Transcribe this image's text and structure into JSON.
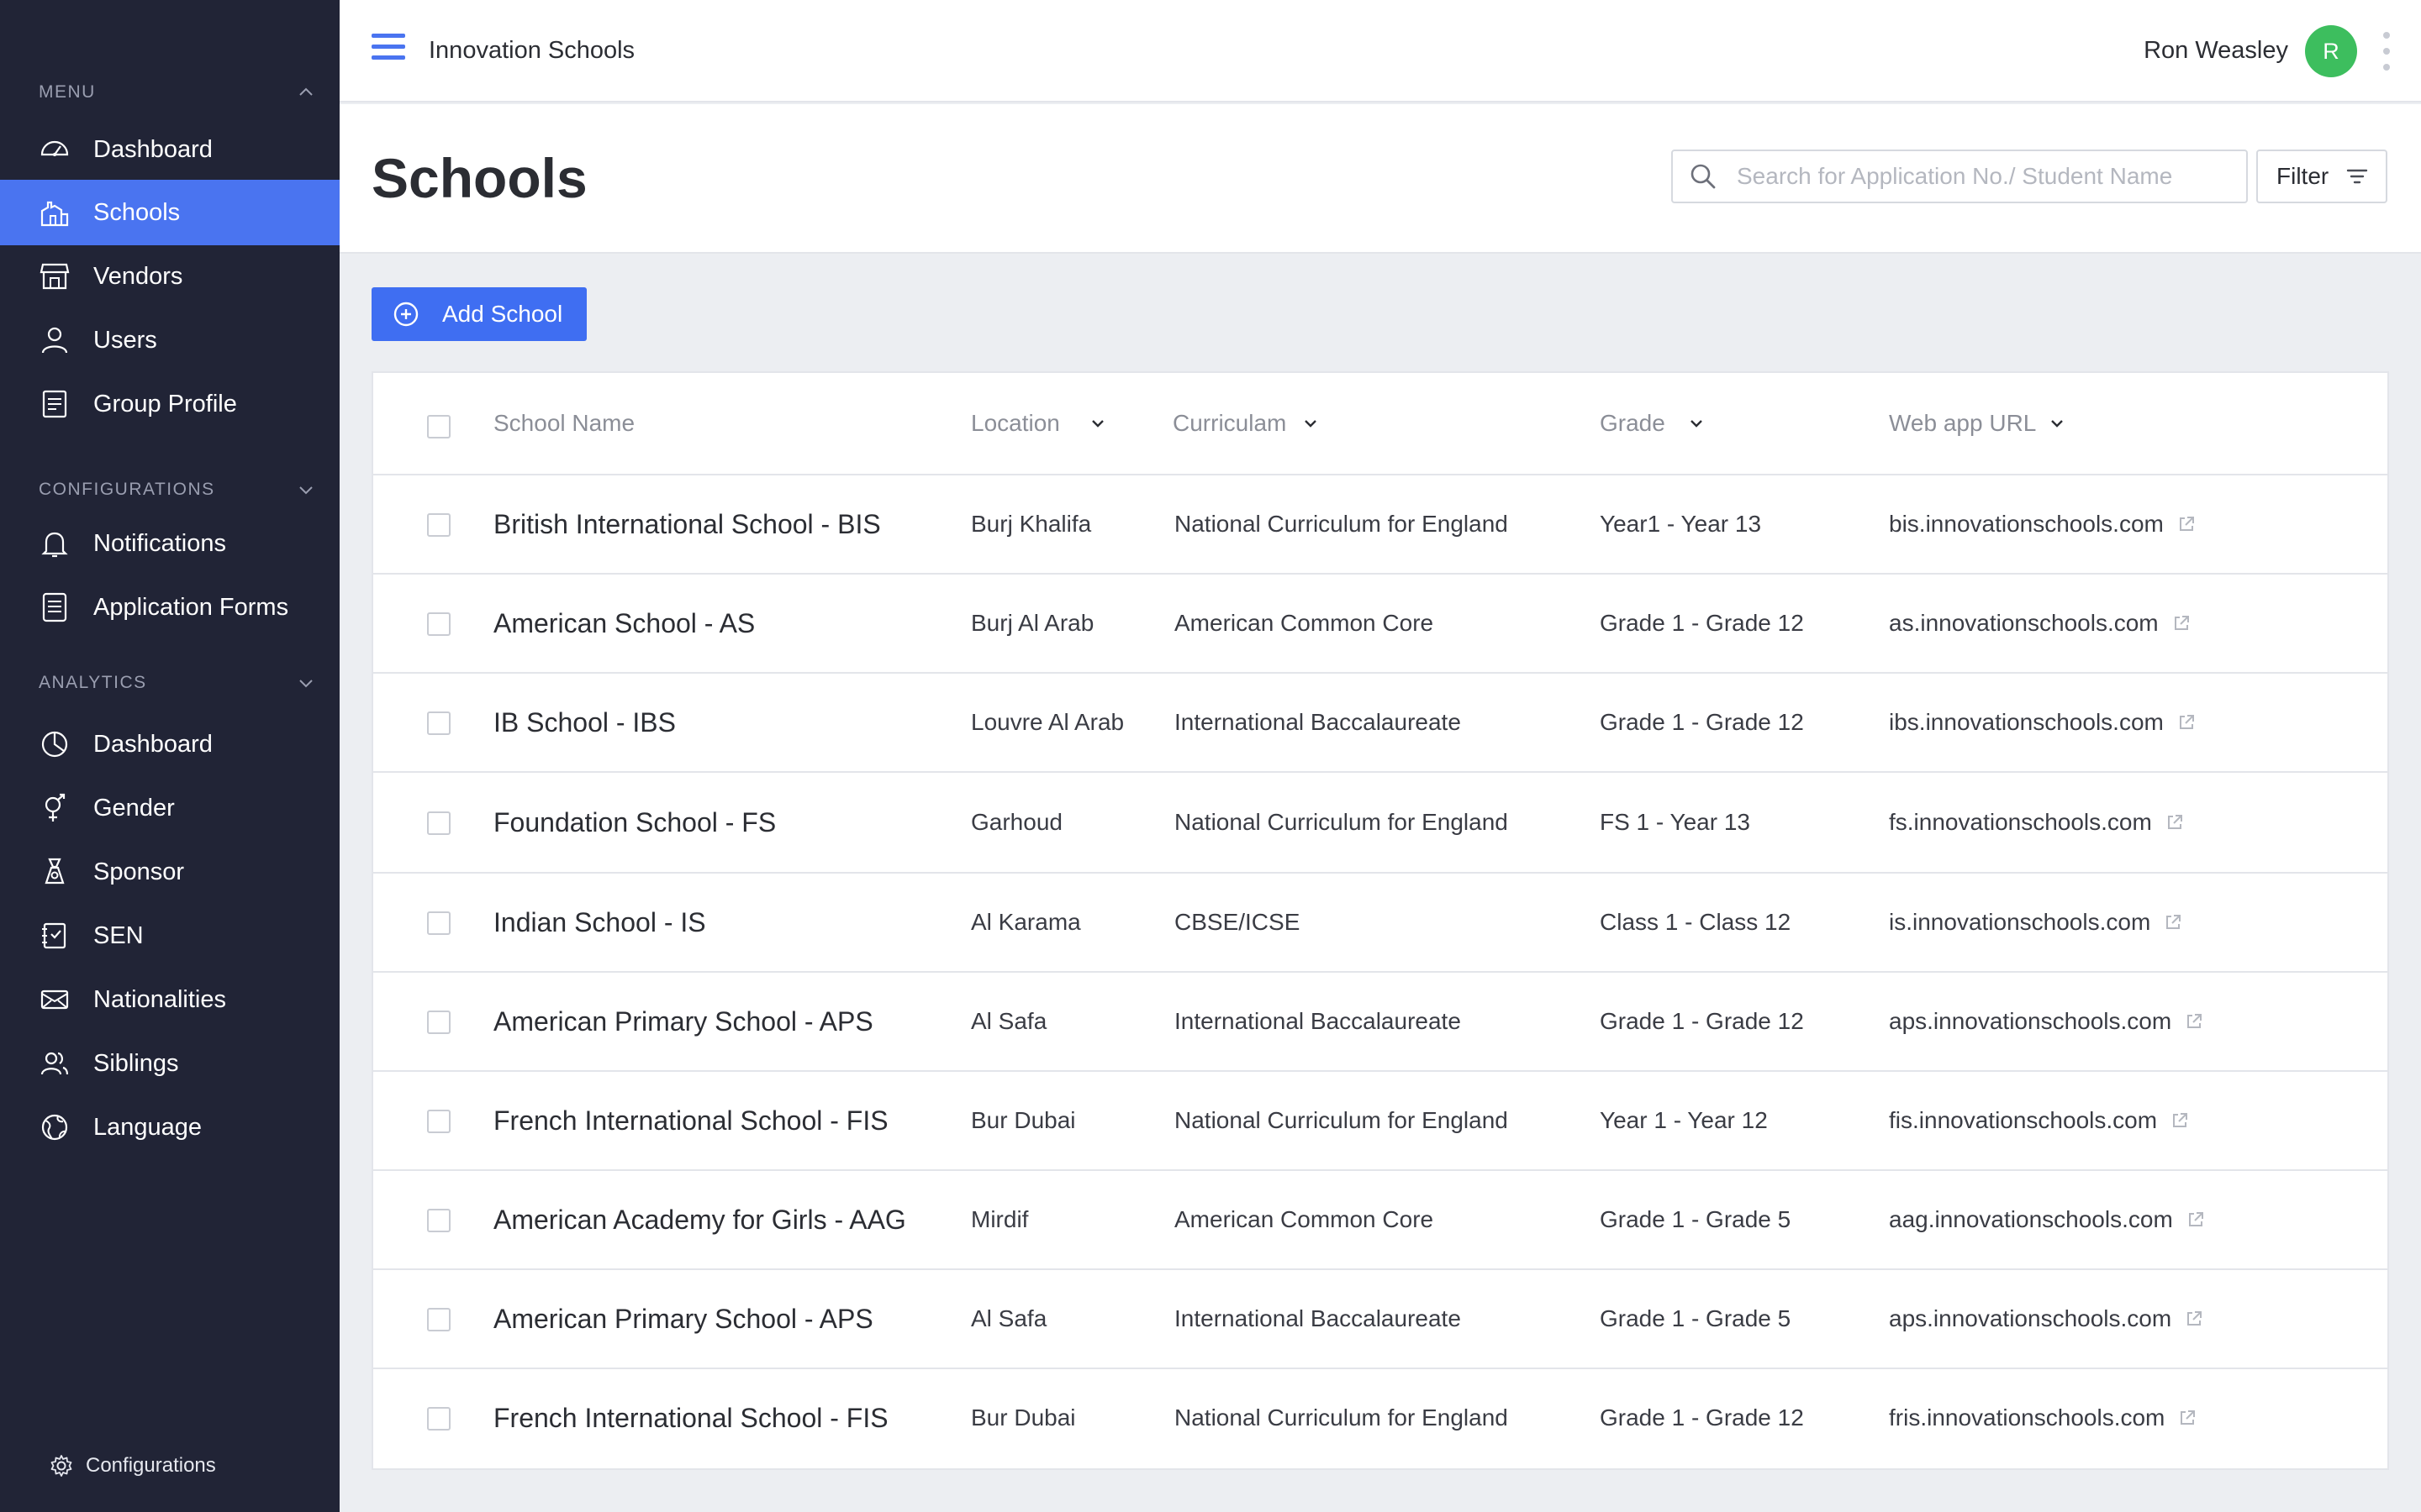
{
  "sidebar": {
    "menu_label": "MENU",
    "menu_items": [
      {
        "label": "Dashboard",
        "icon": "dashboard-icon",
        "active": false
      },
      {
        "label": "Schools",
        "icon": "school-icon",
        "active": true
      },
      {
        "label": "Vendors",
        "icon": "store-icon",
        "active": false
      },
      {
        "label": "Users",
        "icon": "user-icon",
        "active": false
      },
      {
        "label": "Group Profile",
        "icon": "profile-icon",
        "active": false
      }
    ],
    "config_label": "CONFIGURATIONS",
    "config_items": [
      {
        "label": "Notifications",
        "icon": "bell-icon"
      },
      {
        "label": "Application Forms",
        "icon": "form-icon"
      }
    ],
    "analytics_label": "ANALYTICS",
    "analytics_items": [
      {
        "label": "Dashboard",
        "icon": "pie-chart-icon"
      },
      {
        "label": "Gender",
        "icon": "gender-icon"
      },
      {
        "label": "Sponsor",
        "icon": "sponsor-icon"
      },
      {
        "label": "SEN",
        "icon": "sen-icon"
      },
      {
        "label": "Nationalities",
        "icon": "flag-icon"
      },
      {
        "label": "Siblings",
        "icon": "siblings-icon"
      },
      {
        "label": "Language",
        "icon": "globe-icon"
      }
    ],
    "footer_label": "Configurations"
  },
  "topbar": {
    "app_title": "Innovation Schools",
    "user_name": "Ron Weasley",
    "avatar_initial": "R"
  },
  "page": {
    "title": "Schools",
    "search_placeholder": "Search for Application No./ Student Name",
    "filter_label": "Filter",
    "add_button_label": "Add School"
  },
  "table": {
    "columns": {
      "name": "School Name",
      "location": "Location",
      "curriculum": "Curriculam",
      "grade": "Grade",
      "url": "Web app URL"
    },
    "rows": [
      {
        "name": "British International School - BIS",
        "location": "Burj Khalifa",
        "curriculum": "National Curriculum for England",
        "grade": "Year1 - Year 13",
        "url": "bis.innovationschools.com"
      },
      {
        "name": "American School - AS",
        "location": "Burj Al Arab",
        "curriculum": "American Common Core",
        "grade": "Grade 1 - Grade 12",
        "url": "as.innovationschools.com"
      },
      {
        "name": "IB School - IBS",
        "location": "Louvre Al Arab",
        "curriculum": "International Baccalaureate",
        "grade": "Grade 1 - Grade 12",
        "url": "ibs.innovationschools.com"
      },
      {
        "name": "Foundation School - FS",
        "location": "Garhoud",
        "curriculum": "National Curriculum for England",
        "grade": "FS 1 - Year 13",
        "url": "fs.innovationschools.com"
      },
      {
        "name": "Indian School - IS",
        "location": "Al Karama",
        "curriculum": "CBSE/ICSE",
        "grade": "Class 1 - Class 12",
        "url": "is.innovationschools.com"
      },
      {
        "name": "American Primary School - APS",
        "location": "Al Safa",
        "curriculum": "International Baccalaureate",
        "grade": "Grade 1 - Grade 12",
        "url": "aps.innovationschools.com"
      },
      {
        "name": "French International School - FIS",
        "location": "Bur Dubai",
        "curriculum": "National Curriculum for England",
        "grade": "Year 1 - Year 12",
        "url": "fis.innovationschools.com"
      },
      {
        "name": "American Academy for Girls - AAG",
        "location": "Mirdif",
        "curriculum": "American Common Core",
        "grade": "Grade 1 - Grade 5",
        "url": "aag.innovationschools.com"
      },
      {
        "name": "American Primary School - APS",
        "location": "Al Safa",
        "curriculum": "International Baccalaureate",
        "grade": "Grade 1 - Grade 5",
        "url": "aps.innovationschools.com"
      },
      {
        "name": "French International School - FIS",
        "location": "Bur Dubai",
        "curriculum": "National Curriculum for England",
        "grade": "Grade 1 - Grade 12",
        "url": "fris.innovationschools.com"
      }
    ]
  },
  "colors": {
    "sidebar_bg": "#212436",
    "accent": "#4a74f0",
    "avatar": "#3dbe5e"
  }
}
